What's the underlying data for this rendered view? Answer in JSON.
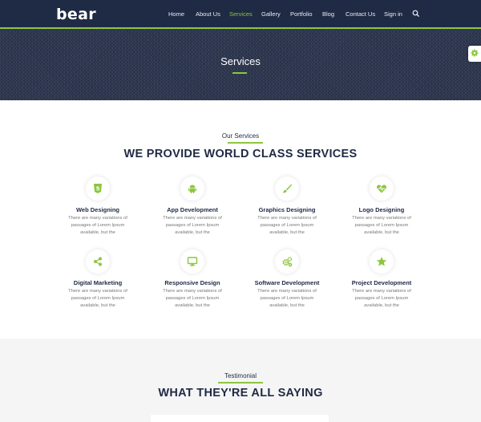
{
  "brand": {
    "name": "bear",
    "accent": "#8cc63f",
    "dark": "#1f2a44"
  },
  "nav": {
    "items": [
      {
        "label": "Home",
        "active": false
      },
      {
        "label": "About Us",
        "active": false
      },
      {
        "label": "Services",
        "active": true
      },
      {
        "label": "Gallery",
        "active": false
      },
      {
        "label": "Portfolio",
        "active": false
      },
      {
        "label": "Blog",
        "active": false
      },
      {
        "label": "Contact Us",
        "active": false
      },
      {
        "label": "Sign in",
        "active": false
      }
    ],
    "search_icon": "search-icon"
  },
  "hero": {
    "title": "Services"
  },
  "settings_icon": "gear-icon",
  "services": {
    "label": "Our Services",
    "heading": "WE PROVIDE WORLD CLASS SERVICES",
    "items": [
      {
        "title": "Web Designing",
        "icon": "html5-icon",
        "text": "There are many variations of passages of Lorem Ipsum available, but the"
      },
      {
        "title": "App Development",
        "icon": "android-icon",
        "text": "There are many variations of passages of Lorem Ipsum available, but the"
      },
      {
        "title": "Graphics Designing",
        "icon": "paint-brush-icon",
        "text": "There are many variations of passages of Lorem Ipsum available, but the"
      },
      {
        "title": "Logo Designing",
        "icon": "heartbeat-icon",
        "text": "There are many variations of passages of Lorem Ipsum available, but the"
      },
      {
        "title": "Digital Marketing",
        "icon": "share-icon",
        "text": "There are many variations of passages of Lorem Ipsum available, but the"
      },
      {
        "title": "Responsive Design",
        "icon": "desktop-icon",
        "text": "There are many variations of passages of Lorem Ipsum available, but the"
      },
      {
        "title": "Software Development",
        "icon": "cogs-icon",
        "text": "There are many variations of passages of Lorem Ipsum available, but the"
      },
      {
        "title": "Project Development",
        "icon": "star-icon",
        "text": "There are many variations of passages of Lorem Ipsum available, but the"
      }
    ]
  },
  "testimonial": {
    "label": "Testimonial",
    "heading": "WHAT THEY'RE ALL SAYING"
  }
}
